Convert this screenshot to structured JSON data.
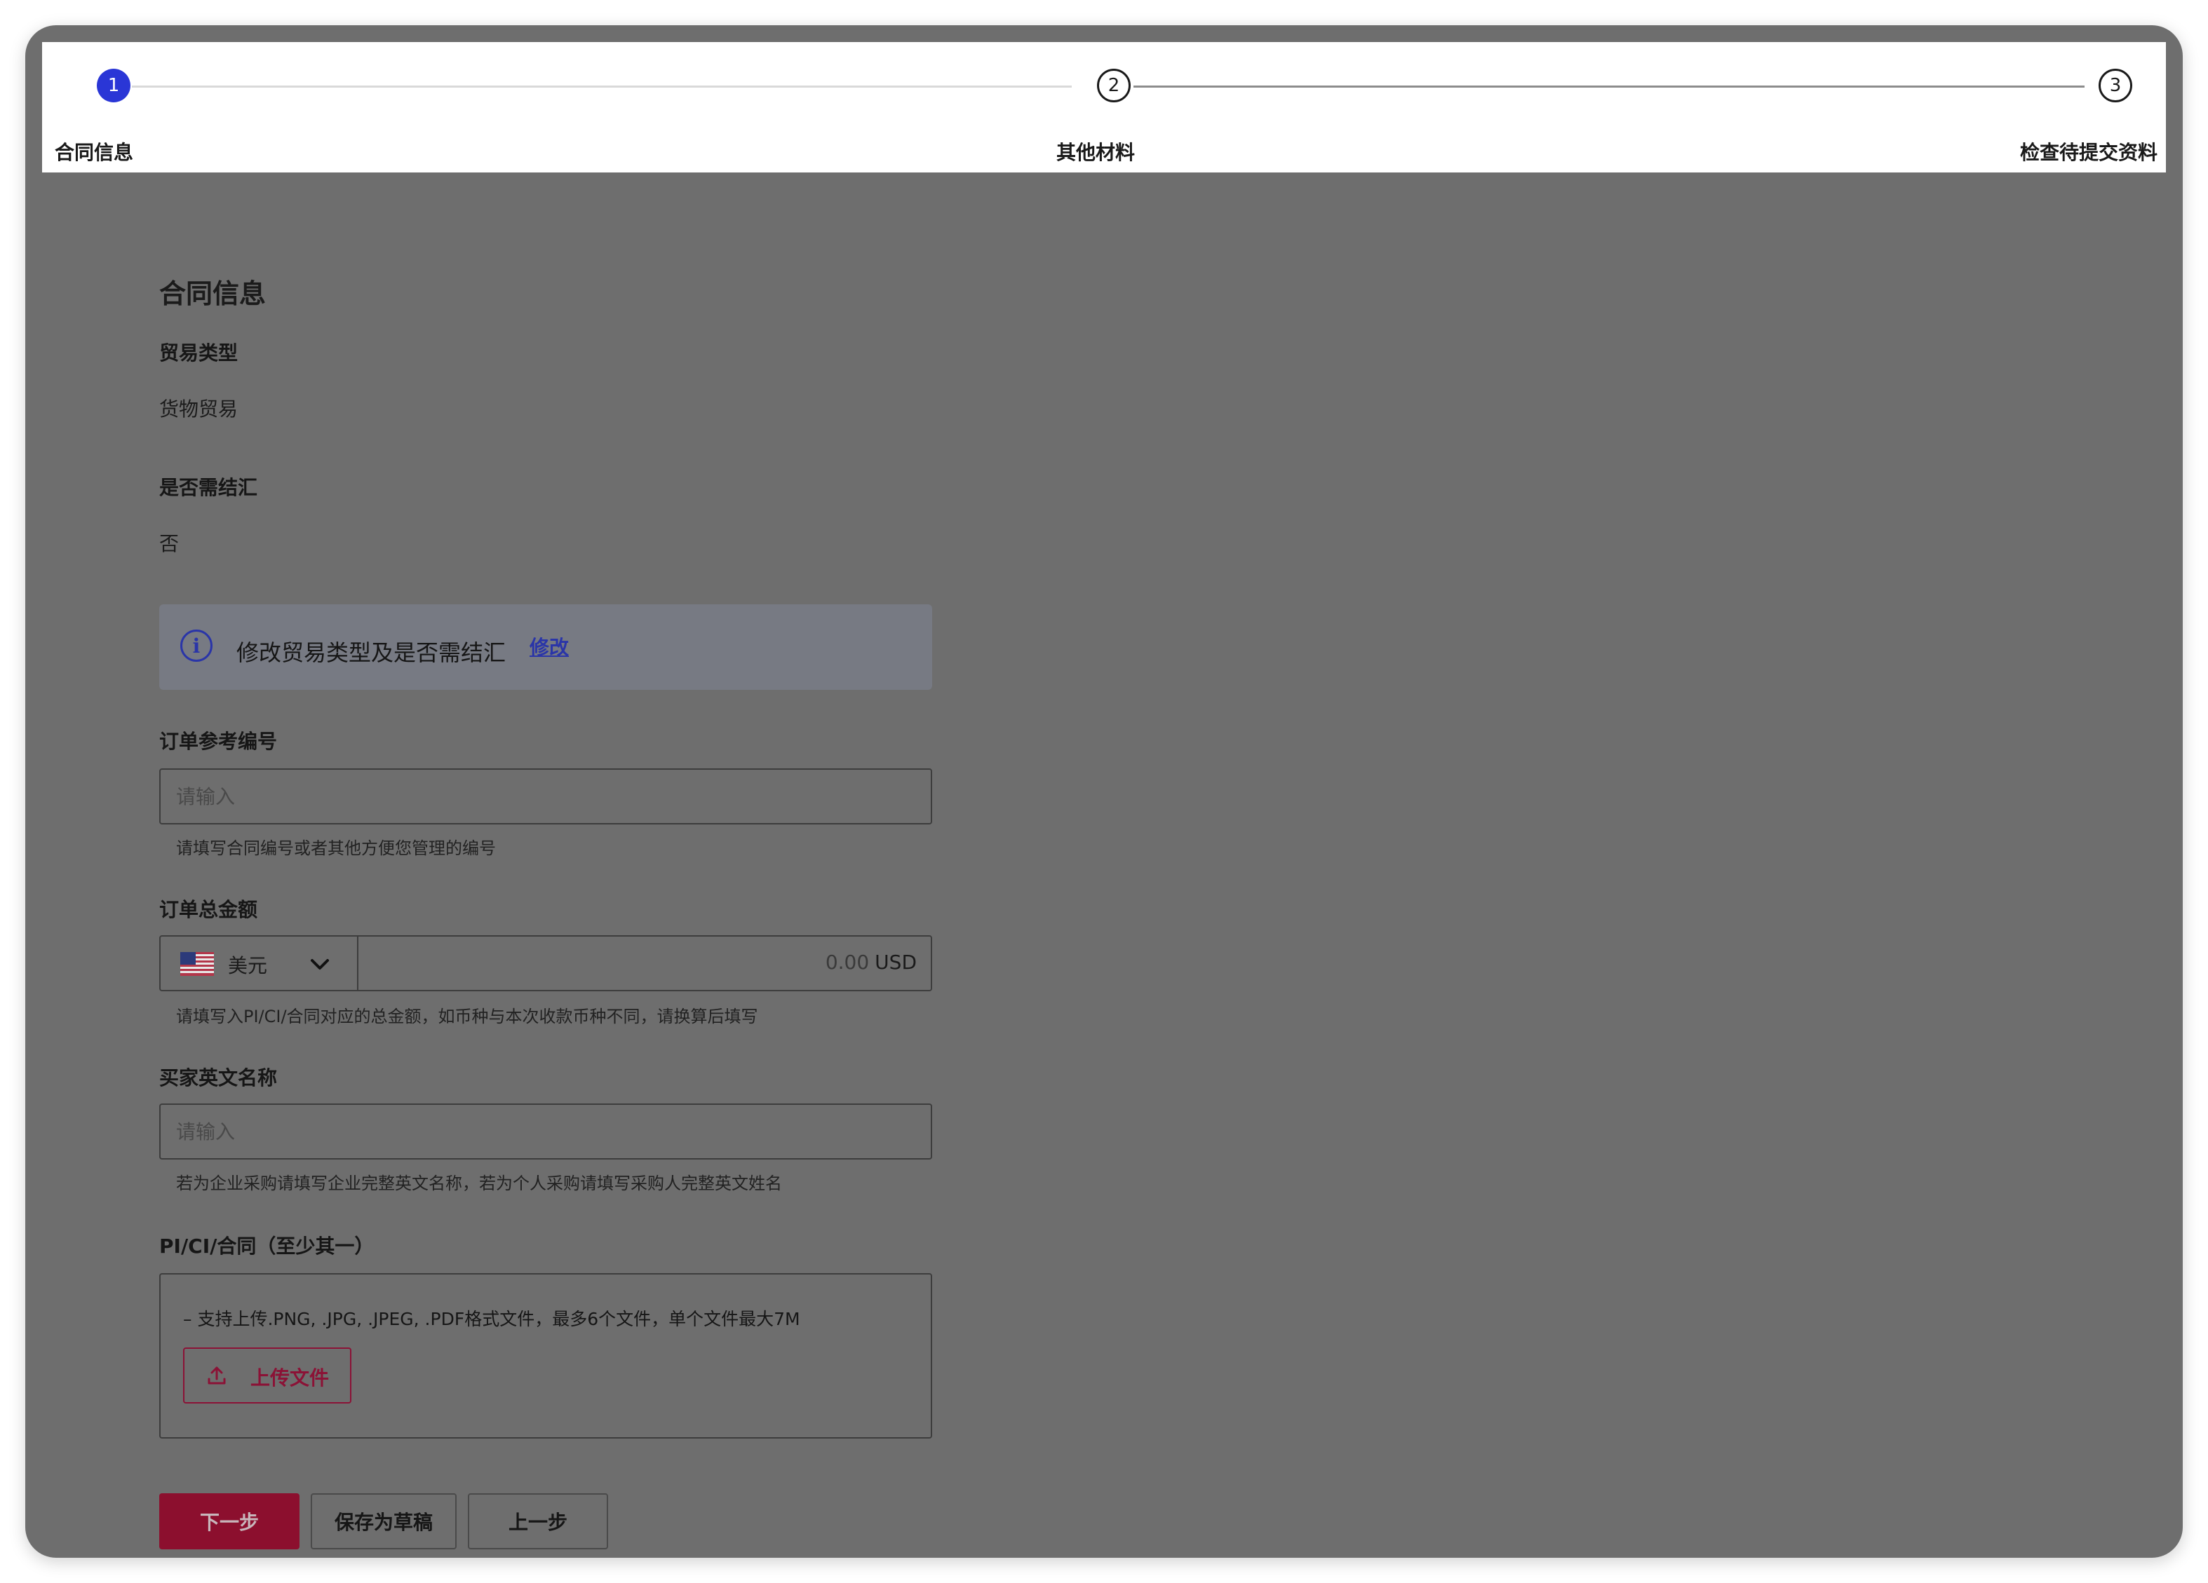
{
  "steps": [
    {
      "number": "1",
      "label": "合同信息",
      "state": "active"
    },
    {
      "number": "2",
      "label": "其他材料",
      "state": "todo"
    },
    {
      "number": "3",
      "label": "检查待提交资料",
      "state": "todo"
    }
  ],
  "section_title": "合同信息",
  "trade_type": {
    "label": "贸易类型",
    "value": "货物贸易"
  },
  "settlement": {
    "label": "是否需结汇",
    "value": "否"
  },
  "info_banner": {
    "icon": "info-icon",
    "text": "修改贸易类型及是否需结汇",
    "link": "修改"
  },
  "order_ref": {
    "label": "订单参考编号",
    "placeholder": "请输入",
    "value": "",
    "hint": "请填写合同编号或者其他方便您管理的编号"
  },
  "order_amount": {
    "label": "订单总金额",
    "currency": "美元",
    "currency_flag": "us-flag",
    "amount": "0.00",
    "unit": "USD",
    "hint": "请填写入PI/CI/合同对应的总金额，如币种与本次收款币种不同，请换算后填写"
  },
  "buyer_name": {
    "label": "买家英文名称",
    "placeholder": "请输入",
    "value": "",
    "hint": "若为企业采购请填写企业完整英文名称，若为个人采购请填写采购人完整英文姓名"
  },
  "documents": {
    "label": "PI/CI/合同（至少其一）",
    "hint": "– 支持上传.PNG, .JPG, .JPEG, .PDF格式文件，最多6个文件，单个文件最大7M",
    "upload_label": "上传文件",
    "upload_icon": "upload-icon"
  },
  "actions": {
    "next": "下一步",
    "save_draft": "保存为草稿",
    "prev": "上一步"
  },
  "colors": {
    "accent": "#2a36d6",
    "brand": "#8c0f2e",
    "link": "#2a35a8",
    "overlay": "#6e6e6e"
  }
}
